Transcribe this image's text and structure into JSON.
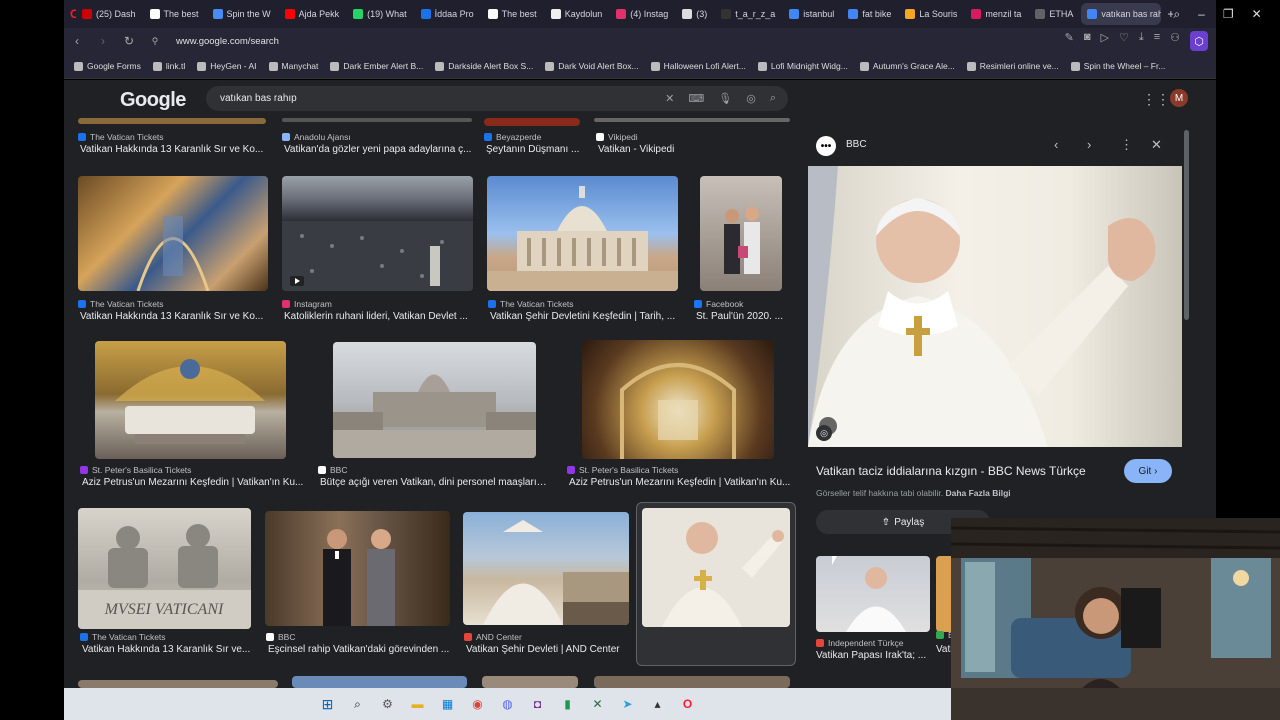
{
  "browser": {
    "tabs": [
      {
        "label": "(25) Dash",
        "color": "#cc0000"
      },
      {
        "label": "The best",
        "color": "#ffffff"
      },
      {
        "label": "Spin the W",
        "color": "#4a8af4"
      },
      {
        "label": "Ajda Pekk",
        "color": "#ff0000"
      },
      {
        "label": "(19) What",
        "color": "#25d366"
      },
      {
        "label": "İddaa Pro",
        "color": "#1a73e8"
      },
      {
        "label": "The best",
        "color": "#ffffff"
      },
      {
        "label": "Kaydolun",
        "color": "#eeeeee"
      },
      {
        "label": "(4) Instag",
        "color": "#e1306c"
      },
      {
        "label": "(3)",
        "color": "#dddddd"
      },
      {
        "label": "t_a_r_z_a",
        "color": "#333333"
      },
      {
        "label": "istanbul",
        "color": "#4285f4"
      },
      {
        "label": "fat bike",
        "color": "#4285f4"
      },
      {
        "label": "La Souris",
        "color": "#f5a623"
      },
      {
        "label": "menzil ta",
        "color": "#d81b60"
      },
      {
        "label": "ETHA",
        "color": "#5f6368"
      },
      {
        "label": "vatıkan bas rahıp",
        "color": "#4285f4"
      }
    ],
    "url": "www.google.com/search",
    "bookmarks": [
      "Google Forms",
      "link.tl",
      "HeyGen - AI",
      "Manychat",
      "Dark Ember Alert B...",
      "Darkside Alert Box S...",
      "Dark Void Alert Box...",
      "Halloween Lofi Alert...",
      "Lofi Midnight Widg...",
      "Autumn's Grace Ale...",
      "Resimleri online ve...",
      "Spin the Wheel – Fr..."
    ]
  },
  "google": {
    "logo": "Google",
    "query": "vatıkan bas rahıp",
    "avatar_letter": "M"
  },
  "results": [
    {
      "source": "The Vatican Tickets",
      "title": "Vatikan Hakkında 13 Karanlık Sır ve Ko...",
      "src_color": "#1a73e8"
    },
    {
      "source": "Anadolu Ajansı",
      "title": "Vatikan'da gözler yeni papa adaylarına ç...",
      "src_color": "#8ab4f8"
    },
    {
      "source": "Beyazperde",
      "title": "Şeytanın Düşmanı ...",
      "src_color": "#1a73e8"
    },
    {
      "source": "Vikipedi",
      "title": "Vatikan - Vikipedi",
      "src_color": "#ffffff"
    },
    {
      "source": "The Vatican Tickets",
      "title": "Vatikan Hakkında 13 Karanlık Sır ve Ko...",
      "src_color": "#1a73e8"
    },
    {
      "source": "Instagram",
      "title": "Katoliklerin ruhani lideri, Vatikan Devlet ...",
      "src_color": "#e1306c"
    },
    {
      "source": "The Vatican Tickets",
      "title": "Vatikan Şehir Devletini Keşfedin | Tarih, ...",
      "src_color": "#1a73e8"
    },
    {
      "source": "Facebook",
      "title": "St. Paul'ün 2020. ...",
      "src_color": "#1877f2"
    },
    {
      "source": "St. Peter's Basilica Tickets",
      "title": "Aziz Petrus'un Mezarını Keşfedin | Vatikan'ın Ku...",
      "src_color": "#9334e6"
    },
    {
      "source": "BBC",
      "title": "Bütçe açığı veren Vatikan, dini personel maaşların...",
      "src_color": "#ffffff"
    },
    {
      "source": "St. Peter's Basilica Tickets",
      "title": "Aziz Petrus'un Mezarını Keşfedin | Vatikan'ın Ku...",
      "src_color": "#9334e6"
    },
    {
      "source": "The Vatican Tickets",
      "title": "Vatikan Hakkında 13 Karanlık Sır ve...",
      "src_color": "#1a73e8"
    },
    {
      "source": "BBC",
      "title": "Eşcinsel rahip Vatikan'daki görevinden ...",
      "src_color": "#ffffff"
    },
    {
      "source": "AND Center",
      "title": "Vatikan Şehir Devleti | AND Center",
      "src_color": "#e8453c"
    },
    {
      "source": "BBC",
      "title": "Vatikan taciz iddialarına kızgın ...",
      "src_color": "#ffffff"
    }
  ],
  "thumb_text": {
    "musei": "MVSEI VATICANI"
  },
  "panel": {
    "source": "BBC",
    "badge": "•••",
    "title": "Vatikan taciz iddialarına kızgın - BBC News Türkçe",
    "go_label": "Git ›",
    "note": "Görseller telif hakkına tabi olabilir.",
    "more_info": "Daha Fazla Bilgi",
    "share_label": "Paylaş",
    "related": [
      {
        "source": "Independent Türkçe",
        "title": "Vatikan Papası Irak'ta; ...",
        "src_color": "#e8453c"
      },
      {
        "source": "E",
        "title": "Vati",
        "src_color": "#34a853"
      }
    ]
  }
}
